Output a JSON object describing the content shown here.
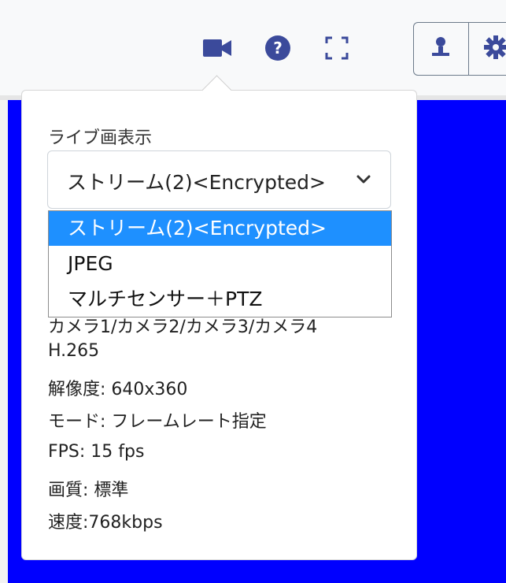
{
  "toolbar": {
    "icons": [
      "video-camera-icon",
      "help-icon",
      "fullscreen-icon",
      "user-icon",
      "gear-icon"
    ],
    "accent_color": "#3b4a9b"
  },
  "popover": {
    "label": "ライブ画表示",
    "select": {
      "value": "ストリーム(2)<Encrypted>",
      "options": [
        "ストリーム(2)<Encrypted>",
        "JPEG",
        "マルチセンサー＋PTZ"
      ],
      "selected_index": 0
    },
    "info": {
      "cameras": "カメラ1/カメラ2/カメラ3/カメラ4",
      "codec": "H.265",
      "resolution": "解像度: 640x360",
      "mode": "モード: フレームレート指定",
      "fps": "FPS: 15 fps",
      "quality": "画質: 標準",
      "speed": "速度:768kbps"
    }
  },
  "colors": {
    "live_view_background": "#0000ff",
    "selected_option": "#1e90ff"
  }
}
